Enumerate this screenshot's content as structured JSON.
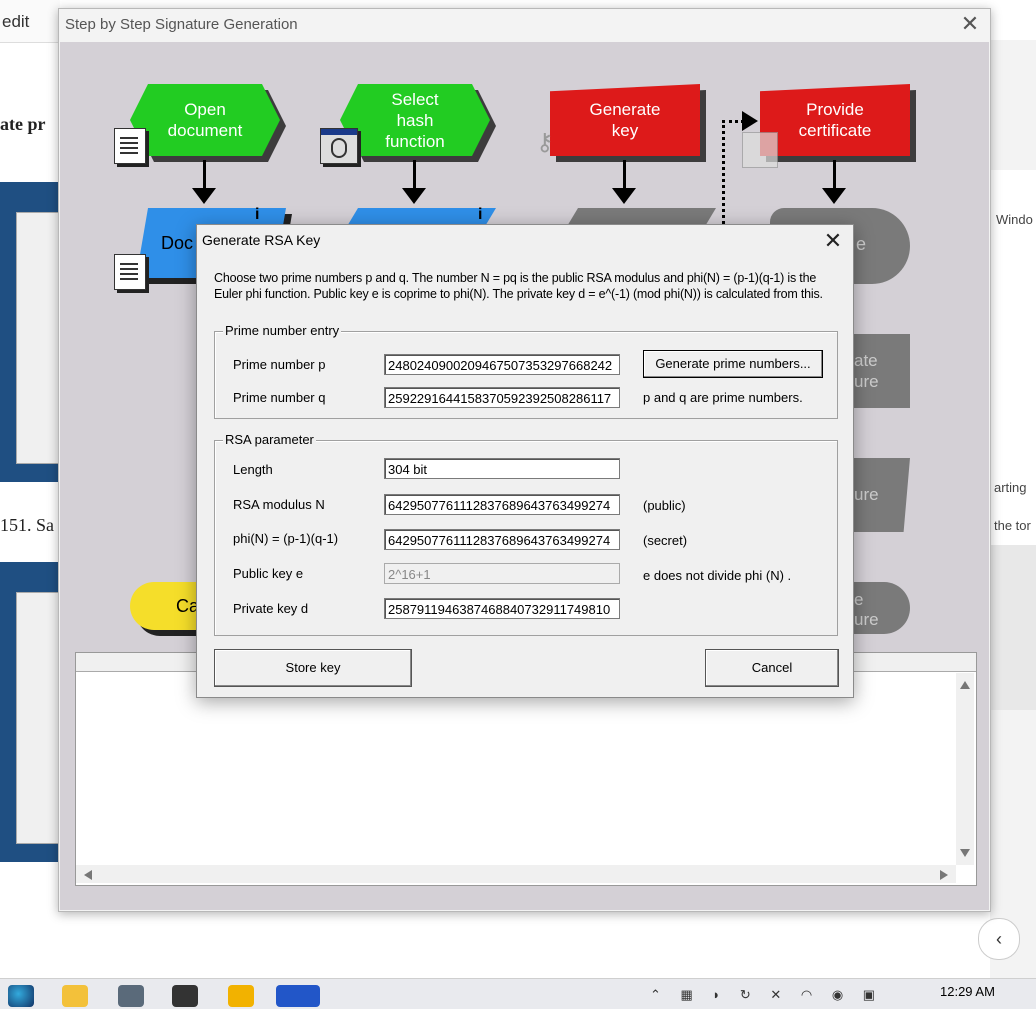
{
  "background": {
    "edit_label": "edit",
    "text_left_top": "ate  pr",
    "text_left_mid": "151.  Sa",
    "right_window_label": "Windo",
    "right_text": "arting",
    "right_text2": "the tor"
  },
  "main_window": {
    "title": "Step by Step Signature Generation",
    "close_glyph": "✕"
  },
  "flowchart": {
    "open_document": "Open document",
    "select_hash": "Select hash function",
    "generate_key": "Generate key",
    "provide_certificate": "Provide certificate",
    "doc_label": "Doc",
    "cancel_partial": "Ca",
    "right_partial_1": "e",
    "right_partial_2a": "ate",
    "right_partial_2b": "ure",
    "right_partial_3": "ure",
    "right_partial_4a": "e",
    "right_partial_4b": "ure",
    "info_glyph": "i"
  },
  "dialog": {
    "title": "Generate RSA Key",
    "close_glyph": "✕",
    "description": "Choose two prime numbers p and q. The number N = pq is the public RSA modulus and phi(N) = (p-1)(q-1) is the Euler phi function. Public key e is coprime to phi(N). The private key  d = e^(-1)  (mod phi(N))  is calculated from this.",
    "prime_group": {
      "label": "Prime number entry",
      "p_label": "Prime number p",
      "p_value": "2480240900209467507353297668242",
      "q_label": "Prime number q",
      "q_value": "2592291644158370592392508286117",
      "generate_button": "Generate prime numbers...",
      "status_text": "p and q are prime numbers."
    },
    "rsa_group": {
      "label": "RSA  parameter",
      "length_label": "Length",
      "length_value": "304 bit",
      "modulus_label": "RSA modulus N",
      "modulus_value": "6429507761112837689643763499274",
      "modulus_note": "(public)",
      "phi_label": "phi(N) = (p-1)(q-1)",
      "phi_value": "6429507761112837689643763499274",
      "phi_note": "(secret)",
      "public_label": "Public key e",
      "public_value": "2^16+1",
      "public_note": "e does not divide phi (N) .",
      "private_label": "Private key d",
      "private_value": "2587911946387468840732911749810"
    },
    "store_button": "Store key",
    "cancel_button": "Cancel"
  },
  "taskbar": {
    "time": "12:29 AM"
  },
  "colors": {
    "green_step": "#22cc22",
    "red_step": "#dd1a1a",
    "blue_step": "#2f8fe8",
    "yellow_step": "#f5de2a",
    "gray_step": "#7a7a7a"
  }
}
